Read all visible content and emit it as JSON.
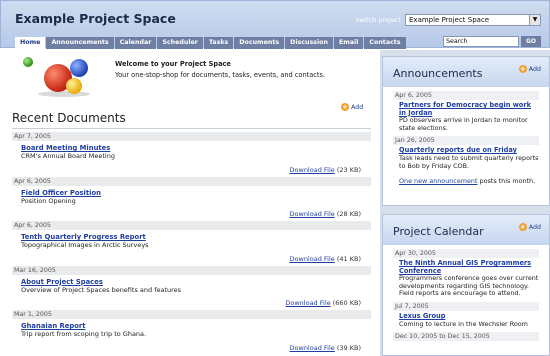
{
  "header": {
    "project_title": "Example Project Space",
    "switch_label": "switch project",
    "switch_value": "Example Project Space",
    "search_placeholder": "Search",
    "search_button": "GO"
  },
  "tabs": [
    {
      "label": "Home",
      "active": true
    },
    {
      "label": "Announcements"
    },
    {
      "label": "Calendar"
    },
    {
      "label": "Scheduler"
    },
    {
      "label": "Tasks"
    },
    {
      "label": "Documents"
    },
    {
      "label": "Discussion"
    },
    {
      "label": "Email"
    },
    {
      "label": "Contacts"
    }
  ],
  "welcome": {
    "title": "Welcome to your Project Space",
    "subtitle": "Your one-stop-shop for documents, tasks, events, and contacts."
  },
  "recent_documents": {
    "heading": "Recent Documents",
    "add_label": "Add",
    "items": [
      {
        "date": "Apr 7, 2005",
        "title": "Board Meeting Minutes",
        "desc": "CRM's Annual Board Meeting",
        "download": "Download File",
        "size": "(23 KB)"
      },
      {
        "date": "Apr 6, 2005",
        "title": "Field Officer Position",
        "desc": "Position Opening",
        "download": "Download File",
        "size": "(28 KB)"
      },
      {
        "date": "Apr 6, 2005",
        "title": "Tenth Quarterly Progress Report",
        "desc": "Topographical Images in Arctic Surveys",
        "download": "Download File",
        "size": "(41 KB)"
      },
      {
        "date": "Mar 16, 2005",
        "title": "About Project Spaces",
        "desc": "Overview of Project Spaces benefits and features",
        "download": "Download File",
        "size": "(660 KB)"
      },
      {
        "date": "Mar 1, 2005",
        "title": "Ghanaian Report",
        "desc": "Trip report from scoping trip to Ghana.",
        "download": "Download File",
        "size": "(39 KB)"
      }
    ]
  },
  "announcements": {
    "heading": "Announcements",
    "add_label": "Add",
    "items": [
      {
        "date": "Apr 6, 2005",
        "title": "Partners for Democracy begin work in Jordan",
        "text": "PD observers arrive in Jordan to monitor state elections."
      },
      {
        "date": "Jan 26, 2005",
        "title": "Quarterly reports due on Friday",
        "text": "Task leads need to submit quarterly reports to Bob by Friday COB."
      }
    ],
    "new_link": "One new announcement",
    "new_suffix": " posts this month."
  },
  "calendar": {
    "heading": "Project Calendar",
    "add_label": "Add",
    "items": [
      {
        "date": "Apr 30, 2005",
        "title": "The Ninth Annual GIS Programmers Conference",
        "text": "Programmers conference goes over current developments regarding GIS technology. Field reports are encourage to attend."
      },
      {
        "date": "Jul 7, 2005",
        "title": "Lexus Group",
        "text": "Coming to lecture in the Wechsler Room"
      },
      {
        "date": "Dec 10, 2005 to Dec 15, 2005",
        "title": "",
        "text": ""
      }
    ]
  }
}
